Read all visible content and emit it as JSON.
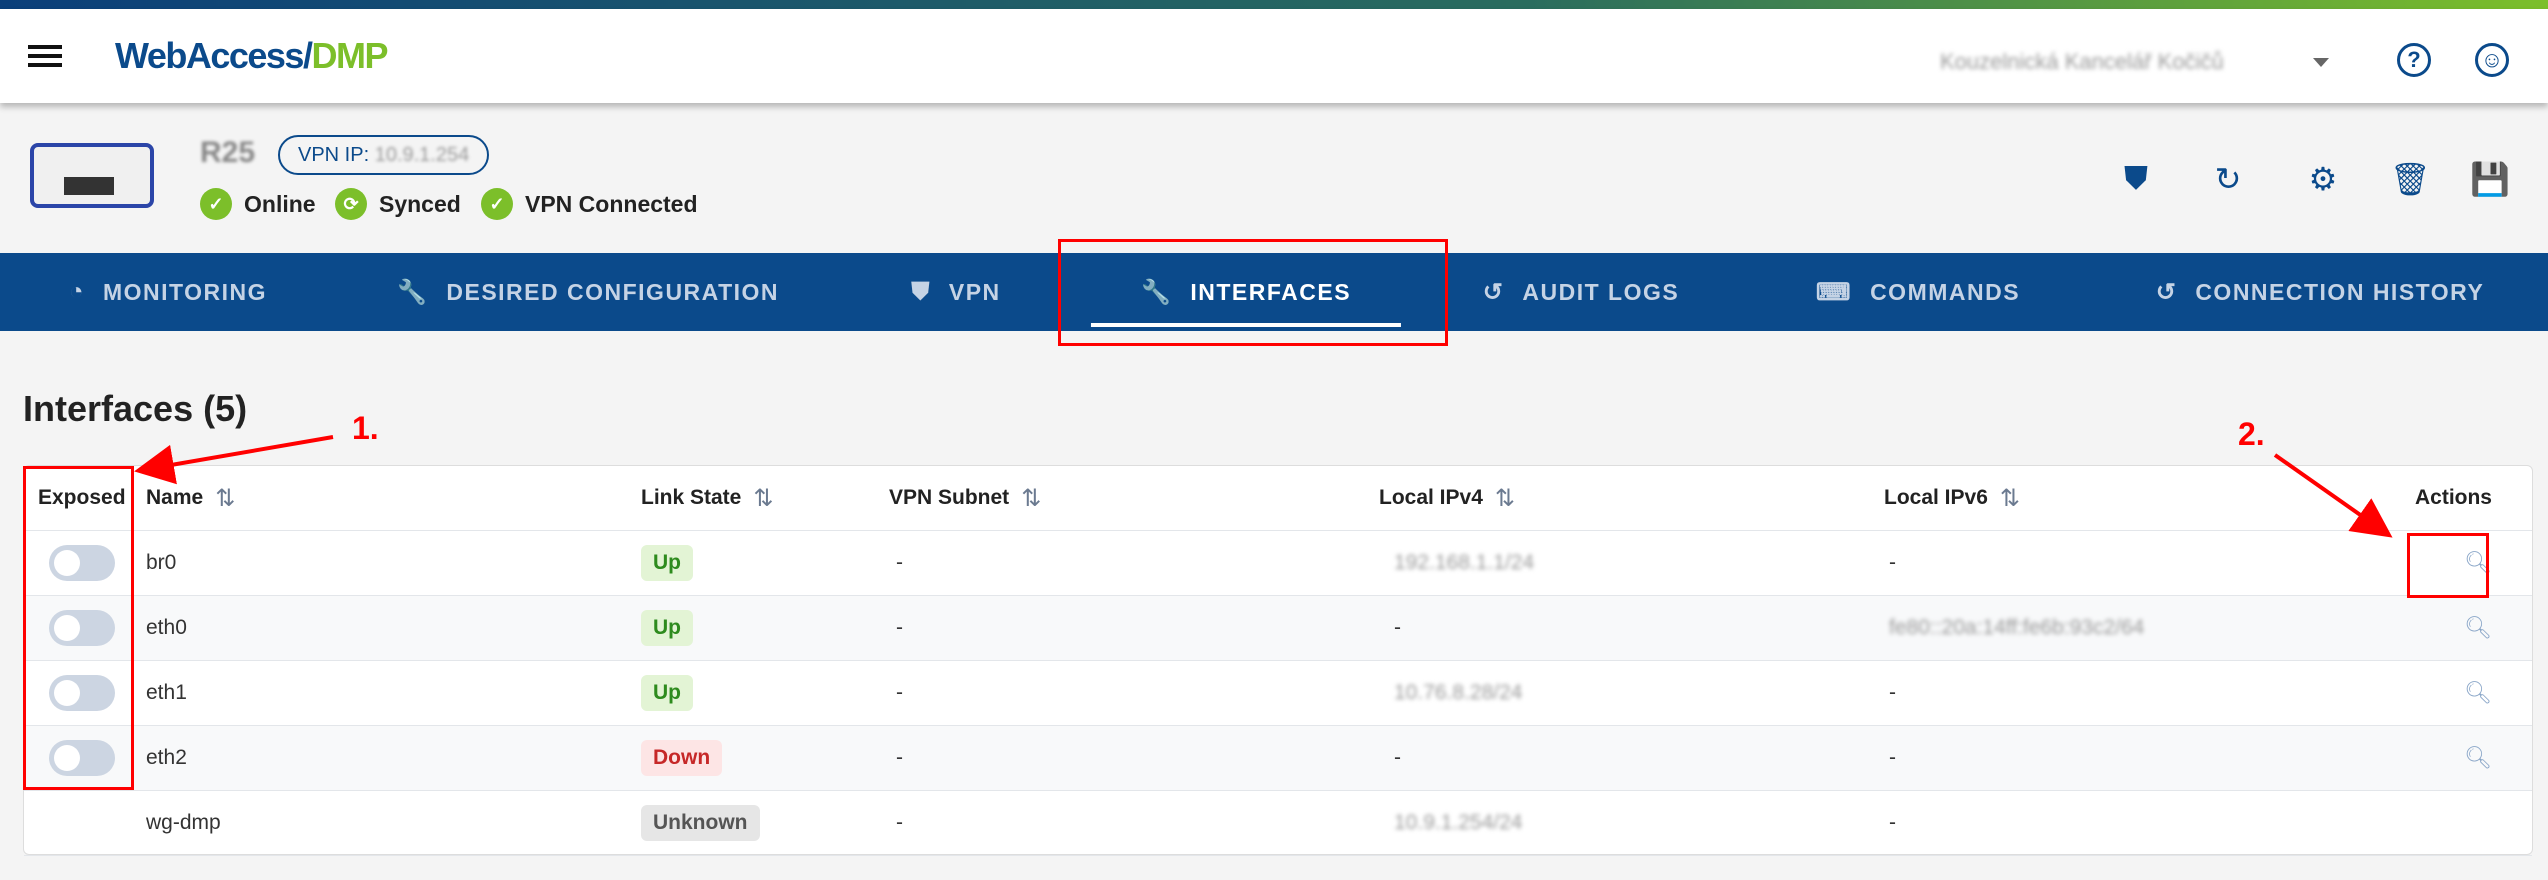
{
  "header": {
    "logo_main": "WebAccess/",
    "logo_accent": "DMP",
    "organization": "Kouzelnická Kancelář Kočičů",
    "help_icon": "?"
  },
  "device": {
    "name": "R25",
    "vpn_ip_label": "VPN IP:",
    "vpn_ip": "10.9.1.254",
    "statuses": [
      "Online",
      "Synced",
      "VPN Connected"
    ]
  },
  "tabs": [
    {
      "label": "MONITORING",
      "icon": "pie-chart"
    },
    {
      "label": "DESIRED CONFIGURATION",
      "icon": "wrench"
    },
    {
      "label": "VPN",
      "icon": "shield"
    },
    {
      "label": "INTERFACES",
      "icon": "wrench",
      "active": true
    },
    {
      "label": "AUDIT LOGS",
      "icon": "history"
    },
    {
      "label": "COMMANDS",
      "icon": "terminal"
    },
    {
      "label": "CONNECTION HISTORY",
      "icon": "history"
    }
  ],
  "page_title": "Interfaces (5)",
  "columns": [
    "Exposed",
    "Name",
    "Link State",
    "VPN Subnet",
    "Local IPv4",
    "Local IPv6",
    "Actions"
  ],
  "rows": [
    {
      "name": "br0",
      "link_state": "Up",
      "vpn_subnet": "-",
      "ipv4": "192.168.1.1/24",
      "ipv6": "-"
    },
    {
      "name": "eth0",
      "link_state": "Up",
      "vpn_subnet": "-",
      "ipv4": "-",
      "ipv6": "fe80::20a:14ff:fe6b:93c2/64"
    },
    {
      "name": "eth1",
      "link_state": "Up",
      "vpn_subnet": "-",
      "ipv4": "10.76.8.28/24",
      "ipv6": "-"
    },
    {
      "name": "eth2",
      "link_state": "Down",
      "vpn_subnet": "-",
      "ipv4": "-",
      "ipv6": "-"
    },
    {
      "name": "wg-dmp",
      "link_state": "Unknown",
      "vpn_subnet": "-",
      "ipv4": "10.9.1.254/24",
      "ipv6": "-"
    }
  ],
  "status_colors": {
    "Up": "#2e8b1e",
    "Down": "#c62828",
    "Unknown": "#555555"
  },
  "annotations": [
    "1.",
    "2."
  ]
}
